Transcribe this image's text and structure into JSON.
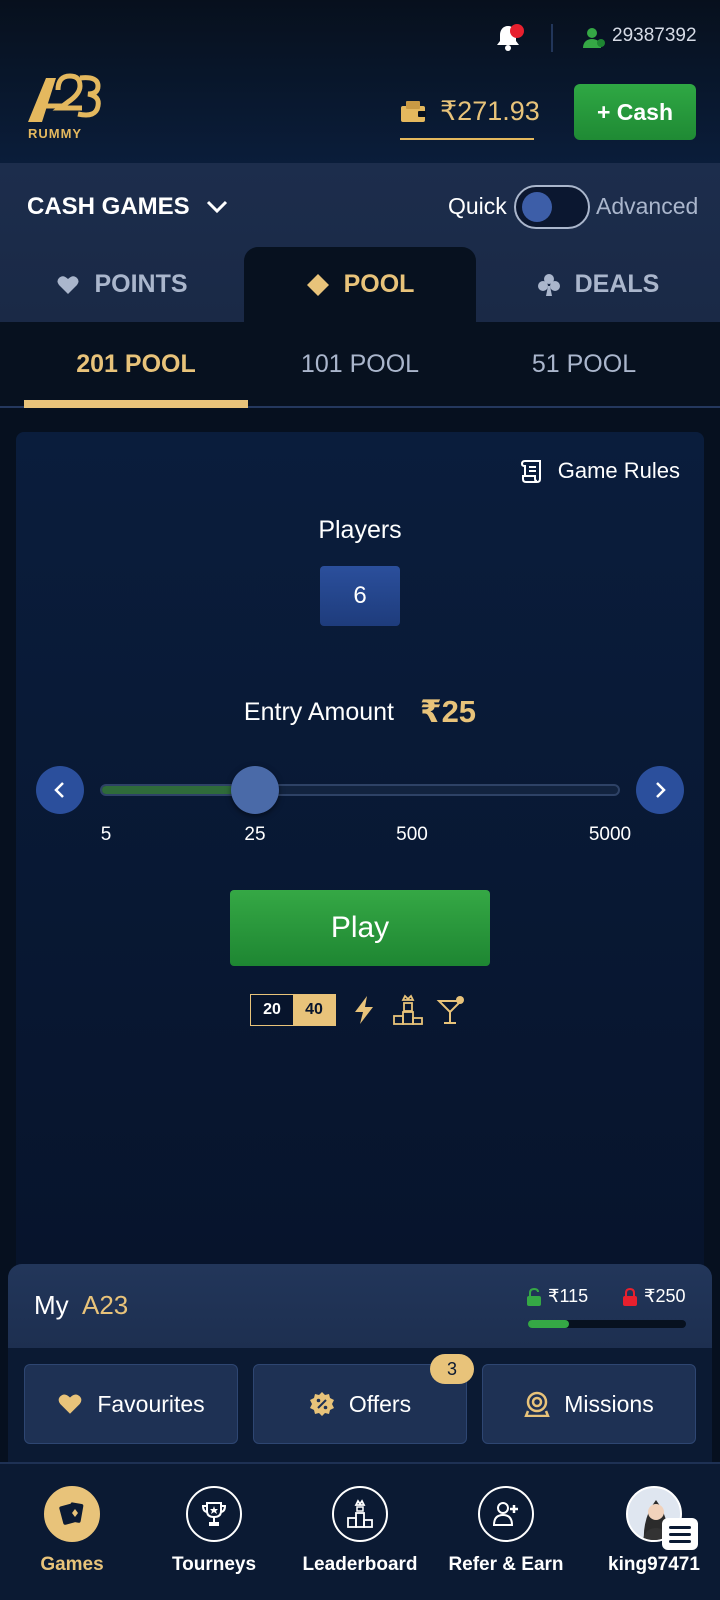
{
  "header": {
    "user_id": "29387392",
    "logo_text": "RUMMY",
    "logo_mark": "A23",
    "wallet_amount": "₹271.93",
    "cash_button_label": "+ Cash"
  },
  "type_bar": {
    "dropdown_label": "CASH GAMES",
    "toggle_left": "Quick",
    "toggle_right": "Advanced",
    "toggle_state": "off",
    "tabs": [
      {
        "label": "POINTS",
        "icon": "heart-icon"
      },
      {
        "label": "POOL",
        "icon": "diamond-icon"
      },
      {
        "label": "DEALS",
        "icon": "club-icon"
      }
    ],
    "active_tab": "POOL"
  },
  "subtabs": {
    "items": [
      "201 POOL",
      "101 POOL",
      "51 POOL"
    ],
    "active": "201 POOL"
  },
  "game_card": {
    "rules_label": "Game Rules",
    "players_label": "Players",
    "players_value": "6",
    "entry_label": "Entry Amount",
    "entry_value": "₹25",
    "slider_ticks": [
      "5",
      "25",
      "500",
      "5000"
    ],
    "slider_selected": "25",
    "slider_fraction": 0.3,
    "play_label": "Play",
    "points_a": "20",
    "points_b": "40",
    "feature_icons": [
      "lightning-icon",
      "podium-icon",
      "cocktail-icon"
    ]
  },
  "my_a23": {
    "title": "My",
    "brand": "A23",
    "unlocked_balance": "₹115",
    "locked_balance": "₹250",
    "balance_fraction": 0.26,
    "buttons": [
      {
        "label": "Favourites",
        "icon": "heart-icon"
      },
      {
        "label": "Offers",
        "icon": "discount-icon",
        "badge": "3"
      },
      {
        "label": "Missions",
        "icon": "target-icon"
      }
    ]
  },
  "bottom_nav": {
    "items": [
      {
        "label": "Games",
        "icon": "cards-icon"
      },
      {
        "label": "Tourneys",
        "icon": "trophy-icon"
      },
      {
        "label": "Leaderboard",
        "icon": "leaderboard-icon"
      },
      {
        "label": "Refer & Earn",
        "icon": "refer-icon"
      },
      {
        "label": "king97471",
        "icon": "avatar"
      }
    ],
    "active": "Games"
  },
  "colors": {
    "accent_gold": "#e8c37a",
    "green": "#2fa844",
    "navy": "#07142c"
  }
}
